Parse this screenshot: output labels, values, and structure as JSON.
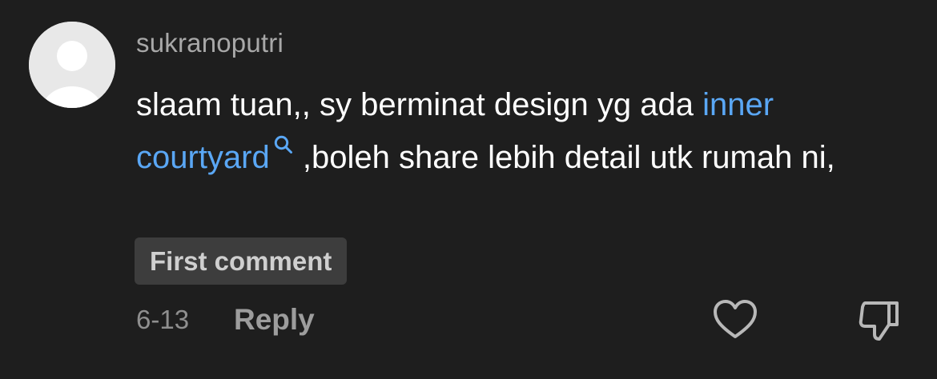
{
  "comment": {
    "username": "sukranoputri",
    "text_before": "slaam tuan,, sy berminat design yg ada ",
    "link_text": "inner courtyard",
    "text_after": " ,boleh share lebih detail utk rumah ni,",
    "badge": "First comment",
    "date": "6-13",
    "reply_label": "Reply",
    "link_color": "#5aa7f5",
    "icons": {
      "avatar": "default-avatar-icon",
      "link": "search-icon",
      "like": "heart-icon",
      "dislike": "thumbs-down-icon"
    }
  }
}
